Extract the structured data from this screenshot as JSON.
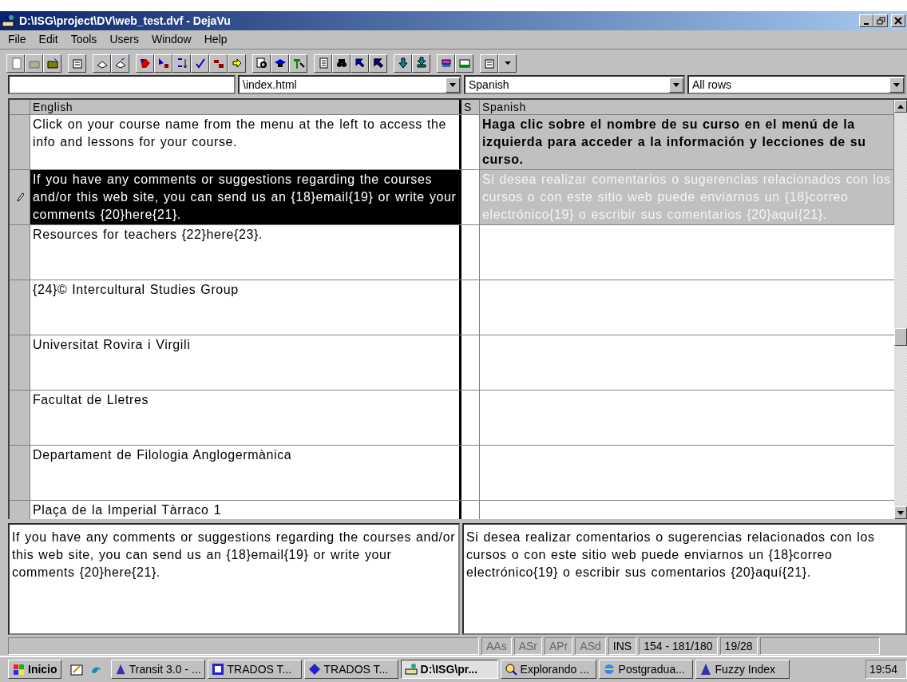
{
  "window": {
    "title": "D:\\ISG\\project\\DV\\web_test.dvf - DejaVu"
  },
  "menu": [
    "File",
    "Edit",
    "Tools",
    "Users",
    "Window",
    "Help"
  ],
  "fields": [
    {
      "kind": "text"
    },
    {
      "kind": "combo",
      "value": "\\index.html"
    },
    {
      "kind": "combo",
      "value": "Spanish"
    },
    {
      "kind": "combo",
      "value": "All rows"
    }
  ],
  "grid": {
    "columns": [
      "English",
      "S",
      "Spanish"
    ],
    "rows": [
      {
        "english": "Click on your course name from the menu at the left to access the info and lessons for your course.",
        "spanish": "Haga clic sobre el nombre de su curso en el menú de la izquierda para acceder a la información y lecciones de su curso.",
        "selected": false,
        "editing": false,
        "translated": true
      },
      {
        "english": "If you have any comments or suggestions regarding the courses and/or this web site, you can send us an {18}email{19} or write your comments {20}here{21}.",
        "spanish": "Si desea realizar comentarios o sugerencias relacionados con los cursos o con este sitio web puede enviarnos un {18}correo electrónico{19} o escribir sus comentarios {20}aquí{21}.",
        "selected": true,
        "editing": true,
        "translated": true
      },
      {
        "english": "Resources for teachers {22}here{23}.",
        "selected": false,
        "editing": false,
        "translated": false
      },
      {
        "english": "{24}© Intercultural Studies Group",
        "selected": false,
        "editing": false,
        "translated": false
      },
      {
        "english": "Universitat Rovira i Virgili",
        "selected": false,
        "editing": false,
        "translated": false
      },
      {
        "english": "Facultat de Lletres",
        "selected": false,
        "editing": false,
        "translated": false
      },
      {
        "english": "Departament de Filologia Anglogermànica",
        "selected": false,
        "editing": false,
        "translated": false
      },
      {
        "english": "Plaça de la Imperial Tàrraco 1",
        "selected": false,
        "editing": false,
        "translated": false
      }
    ]
  },
  "editor": {
    "source": "If you have any comments or suggestions regarding the courses and/or this web site, you can send us an {18}email{19} or write your comments {20}here{21}.",
    "target": "Si desea realizar comentarios o sugerencias relacionados con los cursos o con este sitio web puede enviarnos un {18}correo electrónico{19} o escribir sus comentarios {20}aquí{21}."
  },
  "status_bar": [
    {
      "text": "AAs",
      "disabled": true
    },
    {
      "text": "ASr",
      "disabled": true
    },
    {
      "text": "APr",
      "disabled": true
    },
    {
      "text": "ASd",
      "disabled": true
    },
    {
      "text": "INS",
      "disabled": false
    },
    {
      "text": "154 - 181/180",
      "disabled": false
    },
    {
      "text": "19/28",
      "disabled": false
    }
  ],
  "taskbar": {
    "start": "Inicio",
    "tasks": [
      {
        "label": "Transit 3.0 - ...",
        "selected": false
      },
      {
        "label": "TRADOS T...",
        "selected": false
      },
      {
        "label": "TRADOS T...",
        "selected": false
      },
      {
        "label": "D:\\ISG\\pr...",
        "selected": true
      },
      {
        "label": "Explorando ...",
        "selected": false
      },
      {
        "label": "Postgradua...",
        "selected": false
      },
      {
        "label": "Fuzzy Index",
        "selected": false
      }
    ],
    "clock": "19:54"
  }
}
